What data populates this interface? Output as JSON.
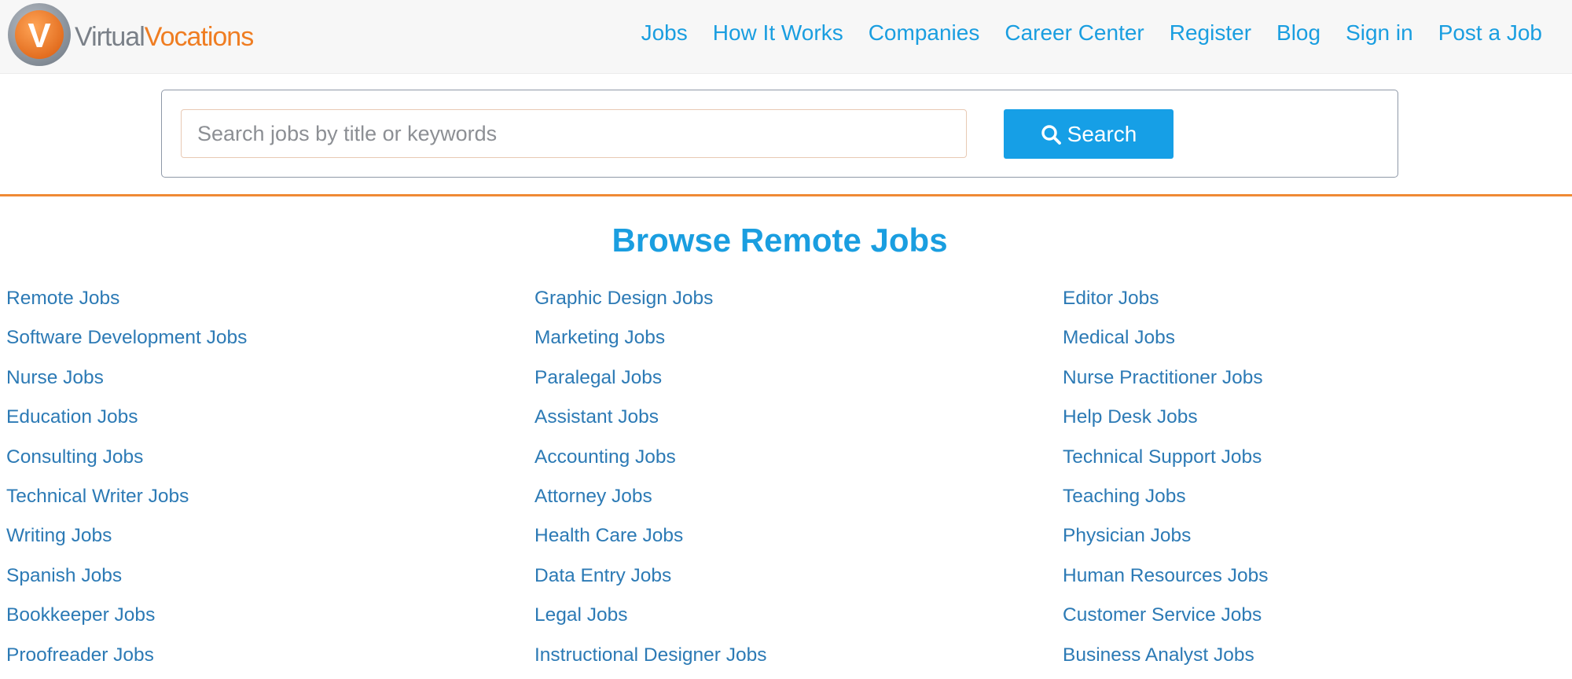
{
  "brand": {
    "logo_letter": "V",
    "name_part1": "Virtual",
    "name_part2": "Vocations",
    "colors": {
      "orange": "#ef7d22",
      "gray": "#7a8088",
      "blue": "#1a9ee0"
    }
  },
  "nav": {
    "items": [
      {
        "label": "Jobs"
      },
      {
        "label": "How It Works"
      },
      {
        "label": "Companies"
      },
      {
        "label": "Career Center"
      },
      {
        "label": "Register"
      },
      {
        "label": "Blog"
      },
      {
        "label": "Sign in"
      },
      {
        "label": "Post a Job"
      }
    ]
  },
  "search": {
    "placeholder": "Search jobs by title or keywords",
    "value": "",
    "button_label": "Search",
    "button_icon": "search-icon"
  },
  "browse": {
    "title": "Browse Remote Jobs",
    "columns": [
      [
        "Remote Jobs",
        "Software Development Jobs",
        "Nurse Jobs",
        "Education Jobs",
        "Consulting Jobs",
        "Technical Writer Jobs",
        "Writing Jobs",
        "Spanish Jobs",
        "Bookkeeper Jobs",
        "Proofreader Jobs"
      ],
      [
        "Graphic Design Jobs",
        "Marketing Jobs",
        "Paralegal Jobs",
        "Assistant Jobs",
        "Accounting Jobs",
        "Attorney Jobs",
        "Health Care Jobs",
        "Data Entry Jobs",
        "Legal Jobs",
        "Instructional Designer Jobs"
      ],
      [
        "Editor Jobs",
        "Medical Jobs",
        "Nurse Practitioner Jobs",
        "Help Desk Jobs",
        "Technical Support Jobs",
        "Teaching Jobs",
        "Physician Jobs",
        "Human Resources Jobs",
        "Customer Service Jobs",
        "Business Analyst Jobs"
      ]
    ]
  }
}
